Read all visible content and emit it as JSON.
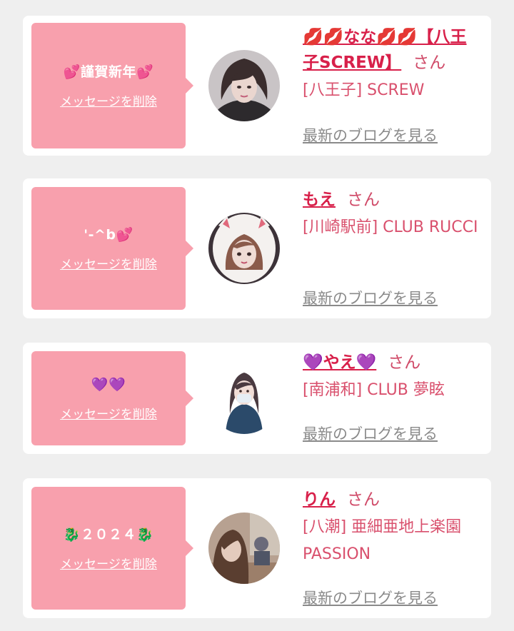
{
  "cards": [
    {
      "message": "💕謹賀新年💕",
      "delete_label": "メッセージを削除",
      "name": "💋💋なな💋💋【八王子SCREW】",
      "honorific": "さん",
      "shop": "[八王子] SCREW",
      "blog_label": "最新のブログを見る",
      "avatar_icon": "profile-photo"
    },
    {
      "message": "'-^b💕",
      "delete_label": "メッセージを削除",
      "name": "もえ",
      "honorific": "さん",
      "shop": "[川崎駅前] CLUB RUCCI",
      "blog_label": "最新のブログを見る",
      "avatar_icon": "profile-photo"
    },
    {
      "message": "💜💜",
      "delete_label": "メッセージを削除",
      "name": "💜やえ💜",
      "honorific": "さん",
      "shop": "[南浦和] CLUB 夢眩",
      "blog_label": "最新のブログを見る",
      "avatar_icon": "profile-photo"
    },
    {
      "message": "🐉２０２４🐉",
      "delete_label": "メッセージを削除",
      "name": "りん",
      "honorific": "さん",
      "shop": "[八潮] 亜細亜地上楽園 PASSION",
      "blog_label": "最新のブログを見る",
      "avatar_icon": "profile-photo"
    }
  ],
  "colors": {
    "background": "#efefef",
    "bubble": "#f8a0ad",
    "name": "#d8204a",
    "shop": "#d9506d",
    "blog_link": "#8a8a8a"
  }
}
